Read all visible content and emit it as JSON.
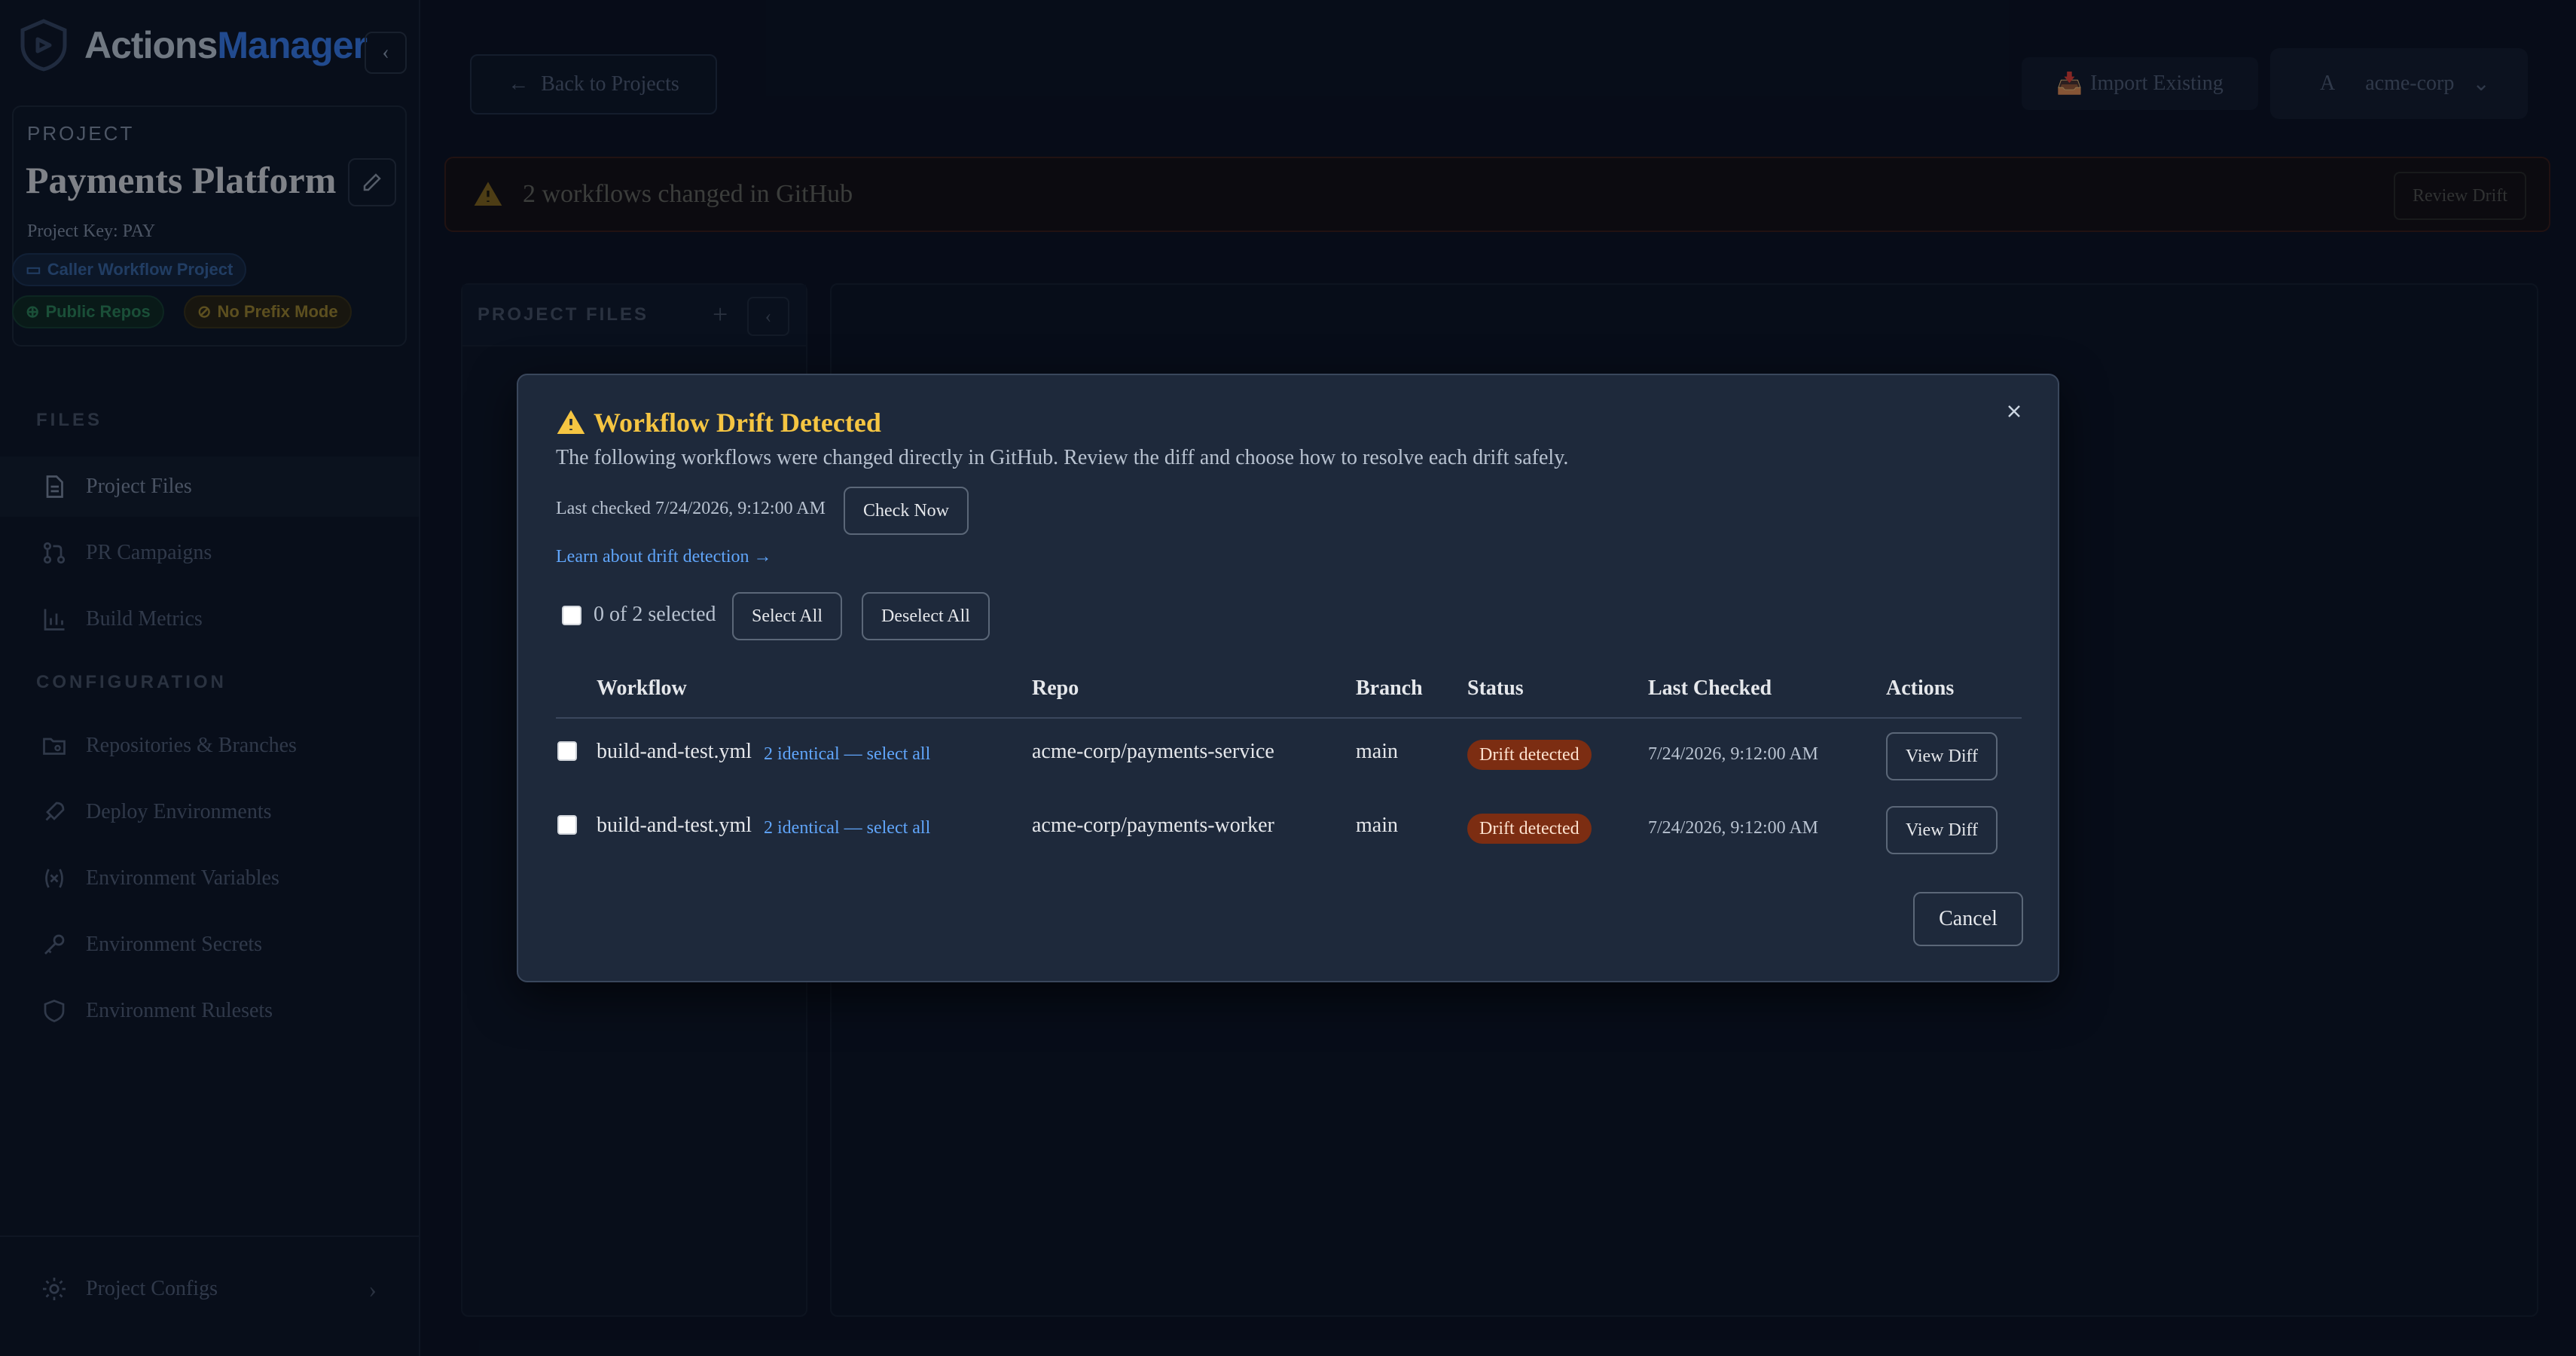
{
  "sidebar": {
    "brand_part1": "Actions",
    "brand_part2": "Manager",
    "project_label": "PROJECT",
    "project_title": "Payments Platform",
    "project_key": "Project Key: PAY",
    "badges": [
      "Caller Workflow Project",
      "Public Repos",
      "No Prefix Mode"
    ],
    "files_label": "FILES",
    "config_label": "CONFIGURATION",
    "items": [
      {
        "label": "Project Files",
        "icon": "file-icon"
      },
      {
        "label": "PR Campaigns",
        "icon": "git-pull-request-icon"
      },
      {
        "label": "Build Metrics",
        "icon": "bar-chart-icon"
      },
      {
        "label": "Repositories & Branches",
        "icon": "folder-git-icon"
      },
      {
        "label": "Deploy Environments",
        "icon": "rocket-icon"
      },
      {
        "label": "Environment Variables",
        "icon": "variable-icon"
      },
      {
        "label": "Environment Secrets",
        "icon": "key-icon"
      },
      {
        "label": "Environment Rulesets",
        "icon": "shield-icon"
      }
    ],
    "footer_label": "Project Configs"
  },
  "header": {
    "back_label": "Back to Projects",
    "import_label": "Import Existing",
    "org_avatar": "A",
    "org_name": "acme-corp"
  },
  "banner": {
    "text": "2 workflows changed in GitHub",
    "button": "Review Drift"
  },
  "files_panel": {
    "label": "PROJECT FILES"
  },
  "modal": {
    "title": "Workflow Drift Detected",
    "description": "The following workflows were changed directly in GitHub. Review the diff and choose how to resolve each drift safely.",
    "last_checked": "Last checked 7/24/2026, 9:12:00 AM",
    "check_now": "Check Now",
    "learn_link": "Learn about drift detection →",
    "selected_count": "0 of 2 selected",
    "select_all": "Select All",
    "deselect_all": "Deselect All",
    "columns": [
      "Workflow",
      "Repo",
      "Branch",
      "Status",
      "Last Checked",
      "Actions"
    ],
    "rows": [
      {
        "workflow": "build-and-test.yml",
        "identical": "2 identical — select all",
        "repo": "acme-corp/payments-service",
        "branch": "main",
        "status": "Drift detected",
        "last_checked": "7/24/2026, 9:12:00 AM",
        "action": "View Diff"
      },
      {
        "workflow": "build-and-test.yml",
        "identical": "2 identical — select all",
        "repo": "acme-corp/payments-worker",
        "branch": "main",
        "status": "Drift detected",
        "last_checked": "7/24/2026, 9:12:00 AM",
        "action": "View Diff"
      }
    ],
    "cancel": "Cancel"
  },
  "colors": {
    "accent": "#3b82f6",
    "warning": "#f5c542",
    "drift_badge": "#7c2d12",
    "link": "#60a5fa"
  }
}
